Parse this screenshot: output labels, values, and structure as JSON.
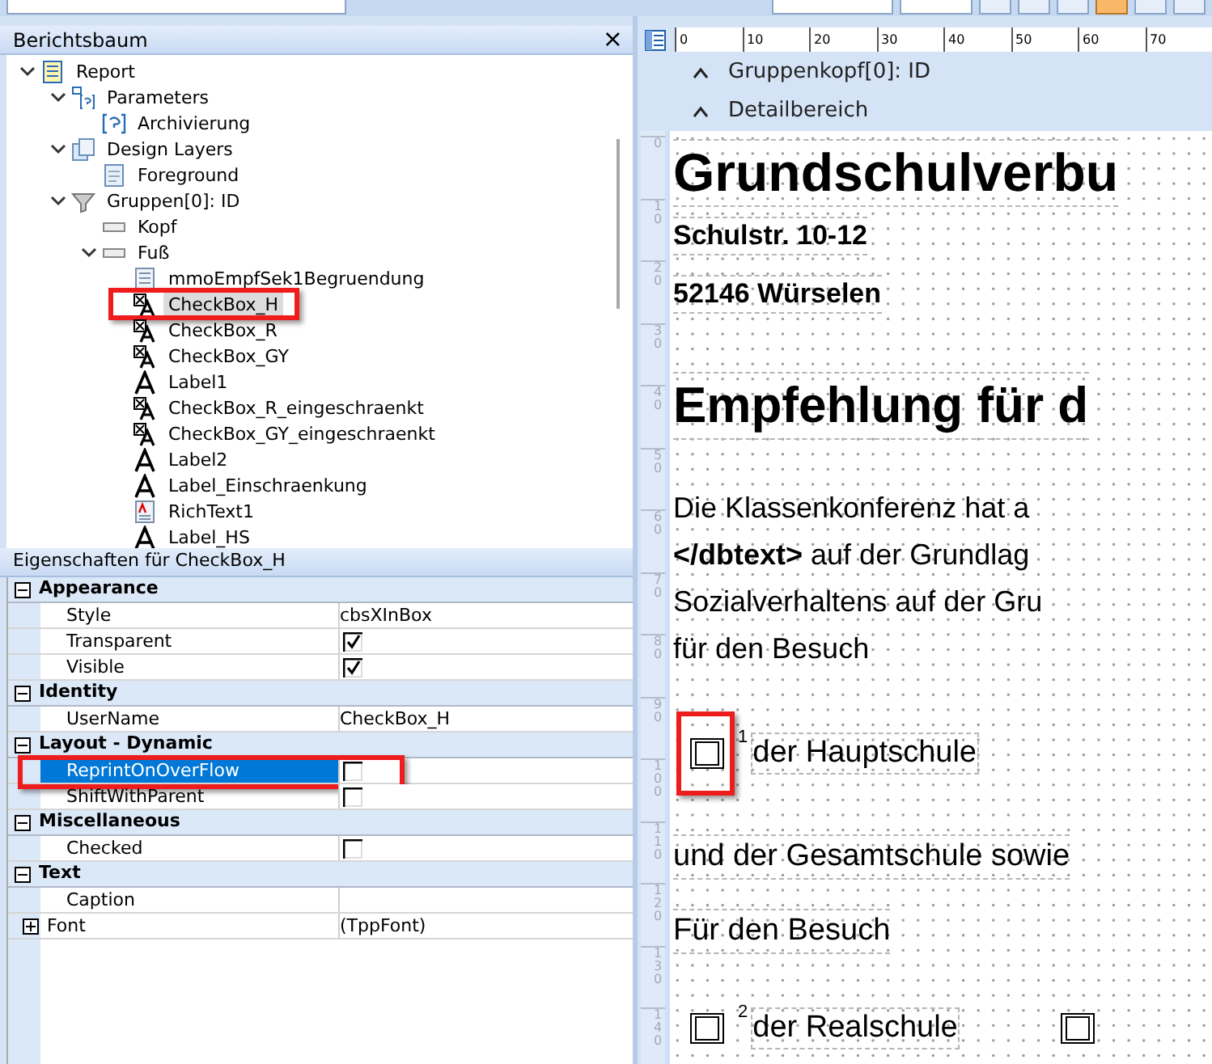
{
  "tree_panel": {
    "title": "Berichtsbaum",
    "close": "×"
  },
  "tree": [
    {
      "label": "Report",
      "kind": "report",
      "expanded": true,
      "selected": false,
      "children": [
        {
          "label": "Parameters",
          "kind": "parameters",
          "expanded": true,
          "selected": false,
          "children": [
            {
              "label": "Archivierung",
              "kind": "param",
              "selected": false
            }
          ]
        },
        {
          "label": "Design Layers",
          "kind": "layers",
          "expanded": true,
          "selected": false,
          "children": [
            {
              "label": "Foreground",
              "kind": "layer",
              "selected": false
            }
          ]
        },
        {
          "label": "Gruppen[0]: ID",
          "kind": "group",
          "expanded": true,
          "selected": false,
          "children": [
            {
              "label": "Kopf",
              "kind": "band",
              "selected": false
            },
            {
              "label": "Fuß",
              "kind": "band",
              "expanded": true,
              "selected": false,
              "children": [
                {
                  "label": "mmoEmpfSek1Begruendung",
                  "kind": "memo",
                  "selected": false
                },
                {
                  "label": "CheckBox_H",
                  "kind": "checkbox",
                  "selected": true,
                  "highlighted": true
                },
                {
                  "label": "CheckBox_R",
                  "kind": "checkbox",
                  "selected": false
                },
                {
                  "label": "CheckBox_GY",
                  "kind": "checkbox",
                  "selected": false
                },
                {
                  "label": "Label1",
                  "kind": "label",
                  "selected": false
                },
                {
                  "label": "CheckBox_R_eingeschraenkt",
                  "kind": "checkbox",
                  "selected": false
                },
                {
                  "label": "CheckBox_GY_eingeschraenkt",
                  "kind": "checkbox",
                  "selected": false
                },
                {
                  "label": "Label2",
                  "kind": "label",
                  "selected": false
                },
                {
                  "label": "Label_Einschraenkung",
                  "kind": "label",
                  "selected": false
                },
                {
                  "label": "RichText1",
                  "kind": "richtext",
                  "selected": false
                },
                {
                  "label": "Label_HS",
                  "kind": "label",
                  "selected": false
                }
              ]
            }
          ]
        }
      ]
    }
  ],
  "properties_panel": {
    "title": "Eigenschaften für CheckBox_H"
  },
  "properties": [
    {
      "category": "Appearance",
      "expanded": true,
      "rows": [
        {
          "name": "Style",
          "kind": "text",
          "value": "cbsXInBox",
          "selected": false
        },
        {
          "name": "Transparent",
          "kind": "check",
          "checked": true,
          "selected": false
        },
        {
          "name": "Visible",
          "kind": "check",
          "checked": true,
          "selected": false
        }
      ]
    },
    {
      "category": "Identity",
      "expanded": true,
      "rows": [
        {
          "name": "UserName",
          "kind": "text",
          "value": "CheckBox_H",
          "selected": false
        }
      ]
    },
    {
      "category": "Layout - Dynamic",
      "expanded": true,
      "rows": [
        {
          "name": "ReprintOnOverFlow",
          "kind": "check",
          "checked": false,
          "selected": true,
          "highlighted": true
        },
        {
          "name": "ShiftWithParent",
          "kind": "check",
          "checked": false,
          "selected": false
        }
      ]
    },
    {
      "category": "Miscellaneous",
      "expanded": true,
      "rows": [
        {
          "name": "Checked",
          "kind": "check",
          "checked": false,
          "selected": false
        }
      ]
    },
    {
      "category": "Text",
      "expanded": true,
      "rows": [
        {
          "name": "Caption",
          "kind": "text",
          "selected": false
        },
        {
          "name": "Font",
          "kind": "text",
          "value": "(TppFont)",
          "expandable": true,
          "selected": false
        }
      ]
    }
  ],
  "ruler": {
    "horizontal": [
      "0",
      "10",
      "20",
      "30",
      "40",
      "50",
      "60",
      "70"
    ],
    "vertical": [
      "0",
      "10",
      "20",
      "30",
      "40",
      "50",
      "60",
      "70",
      "80",
      "90",
      "100",
      "110",
      "120",
      "130",
      "140"
    ]
  },
  "bands": [
    "Gruppenkopf[0]: ID",
    "Detailbereich"
  ],
  "document": [
    {
      "kind": "title",
      "text": "Grundschulverbu"
    },
    {
      "kind": "address",
      "text": "Schulstr. 10-12"
    },
    {
      "kind": "address",
      "text": "52146 Würselen"
    },
    {
      "kind": "heading",
      "text": "Empfehlung für d"
    },
    {
      "kind": "paragraph",
      "lines": [
        "Die  Klassenkonferenz  hat  a",
        "**</dbtext>**  auf der Grundlag",
        "Sozialverhaltens auf der Gru",
        "für den Besuch"
      ]
    },
    {
      "kind": "checkbox",
      "checked": false,
      "number": "1",
      "text": "der Hauptschule",
      "highlighted": true
    },
    {
      "kind": "line",
      "text": "und der Gesamtschule sowie"
    },
    {
      "kind": "line",
      "text": "Für den Besuch"
    },
    {
      "kind": "checkbox",
      "checked": false,
      "number": "2",
      "text": "der Realschule",
      "second_checkbox": {
        "checked": false
      }
    }
  ]
}
